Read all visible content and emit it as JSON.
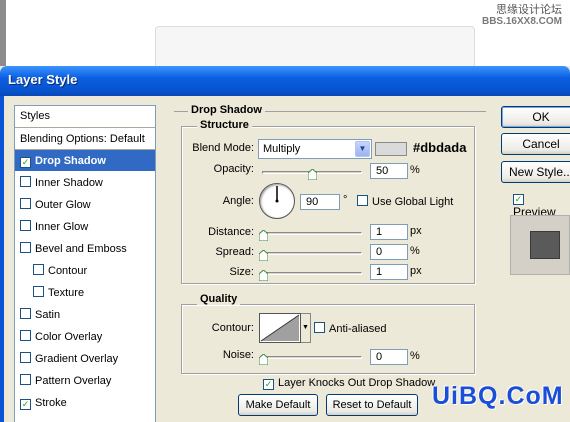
{
  "watermark": {
    "top_line1": "思缘设计论坛",
    "top_line2": "BBS.16XX8.COM",
    "bottom": "UiBQ.CoM"
  },
  "dialog": {
    "title": "Layer Style"
  },
  "styles": {
    "header": "Styles",
    "items": [
      {
        "label": "Blending Options: Default",
        "checkbox": false,
        "checked": false,
        "selected": false,
        "indent": false
      },
      {
        "label": "Drop Shadow",
        "checkbox": true,
        "checked": true,
        "selected": true,
        "indent": false
      },
      {
        "label": "Inner Shadow",
        "checkbox": true,
        "checked": false,
        "selected": false,
        "indent": false
      },
      {
        "label": "Outer Glow",
        "checkbox": true,
        "checked": false,
        "selected": false,
        "indent": false
      },
      {
        "label": "Inner Glow",
        "checkbox": true,
        "checked": false,
        "selected": false,
        "indent": false
      },
      {
        "label": "Bevel and Emboss",
        "checkbox": true,
        "checked": false,
        "selected": false,
        "indent": false
      },
      {
        "label": "Contour",
        "checkbox": true,
        "checked": false,
        "selected": false,
        "indent": true
      },
      {
        "label": "Texture",
        "checkbox": true,
        "checked": false,
        "selected": false,
        "indent": true
      },
      {
        "label": "Satin",
        "checkbox": true,
        "checked": false,
        "selected": false,
        "indent": false
      },
      {
        "label": "Color Overlay",
        "checkbox": true,
        "checked": false,
        "selected": false,
        "indent": false
      },
      {
        "label": "Gradient Overlay",
        "checkbox": true,
        "checked": false,
        "selected": false,
        "indent": false
      },
      {
        "label": "Pattern Overlay",
        "checkbox": true,
        "checked": false,
        "selected": false,
        "indent": false
      },
      {
        "label": "Stroke",
        "checkbox": true,
        "checked": true,
        "selected": false,
        "indent": false
      }
    ]
  },
  "drop_shadow": {
    "section_title": "Drop Shadow",
    "structure": {
      "title": "Structure",
      "blend_mode_label": "Blend Mode:",
      "blend_mode_value": "Multiply",
      "color_hex": "#dbdada",
      "color_label": "#dbdada",
      "opacity_label": "Opacity:",
      "opacity_value": "50",
      "opacity_unit": "%",
      "opacity_fraction": 0.5,
      "angle_label": "Angle:",
      "angle_value": "90",
      "angle_unit": "°",
      "use_global_light_label": "Use Global Light",
      "use_global_light_checked": false,
      "distance_label": "Distance:",
      "distance_value": "1",
      "distance_unit": "px",
      "spread_label": "Spread:",
      "spread_value": "0",
      "spread_unit": "%",
      "size_label": "Size:",
      "size_value": "1",
      "size_unit": "px"
    },
    "quality": {
      "title": "Quality",
      "contour_label": "Contour:",
      "anti_aliased_label": "Anti-aliased",
      "anti_aliased_checked": false,
      "noise_label": "Noise:",
      "noise_value": "0",
      "noise_unit": "%"
    },
    "knocks_out_label": "Layer Knocks Out Drop Shadow",
    "knocks_out_checked": true,
    "make_default_label": "Make Default",
    "reset_default_label": "Reset to Default"
  },
  "buttons": {
    "ok": "OK",
    "cancel": "Cancel",
    "new_style": "New Style...",
    "preview_label": "Preview",
    "preview_checked": true
  }
}
